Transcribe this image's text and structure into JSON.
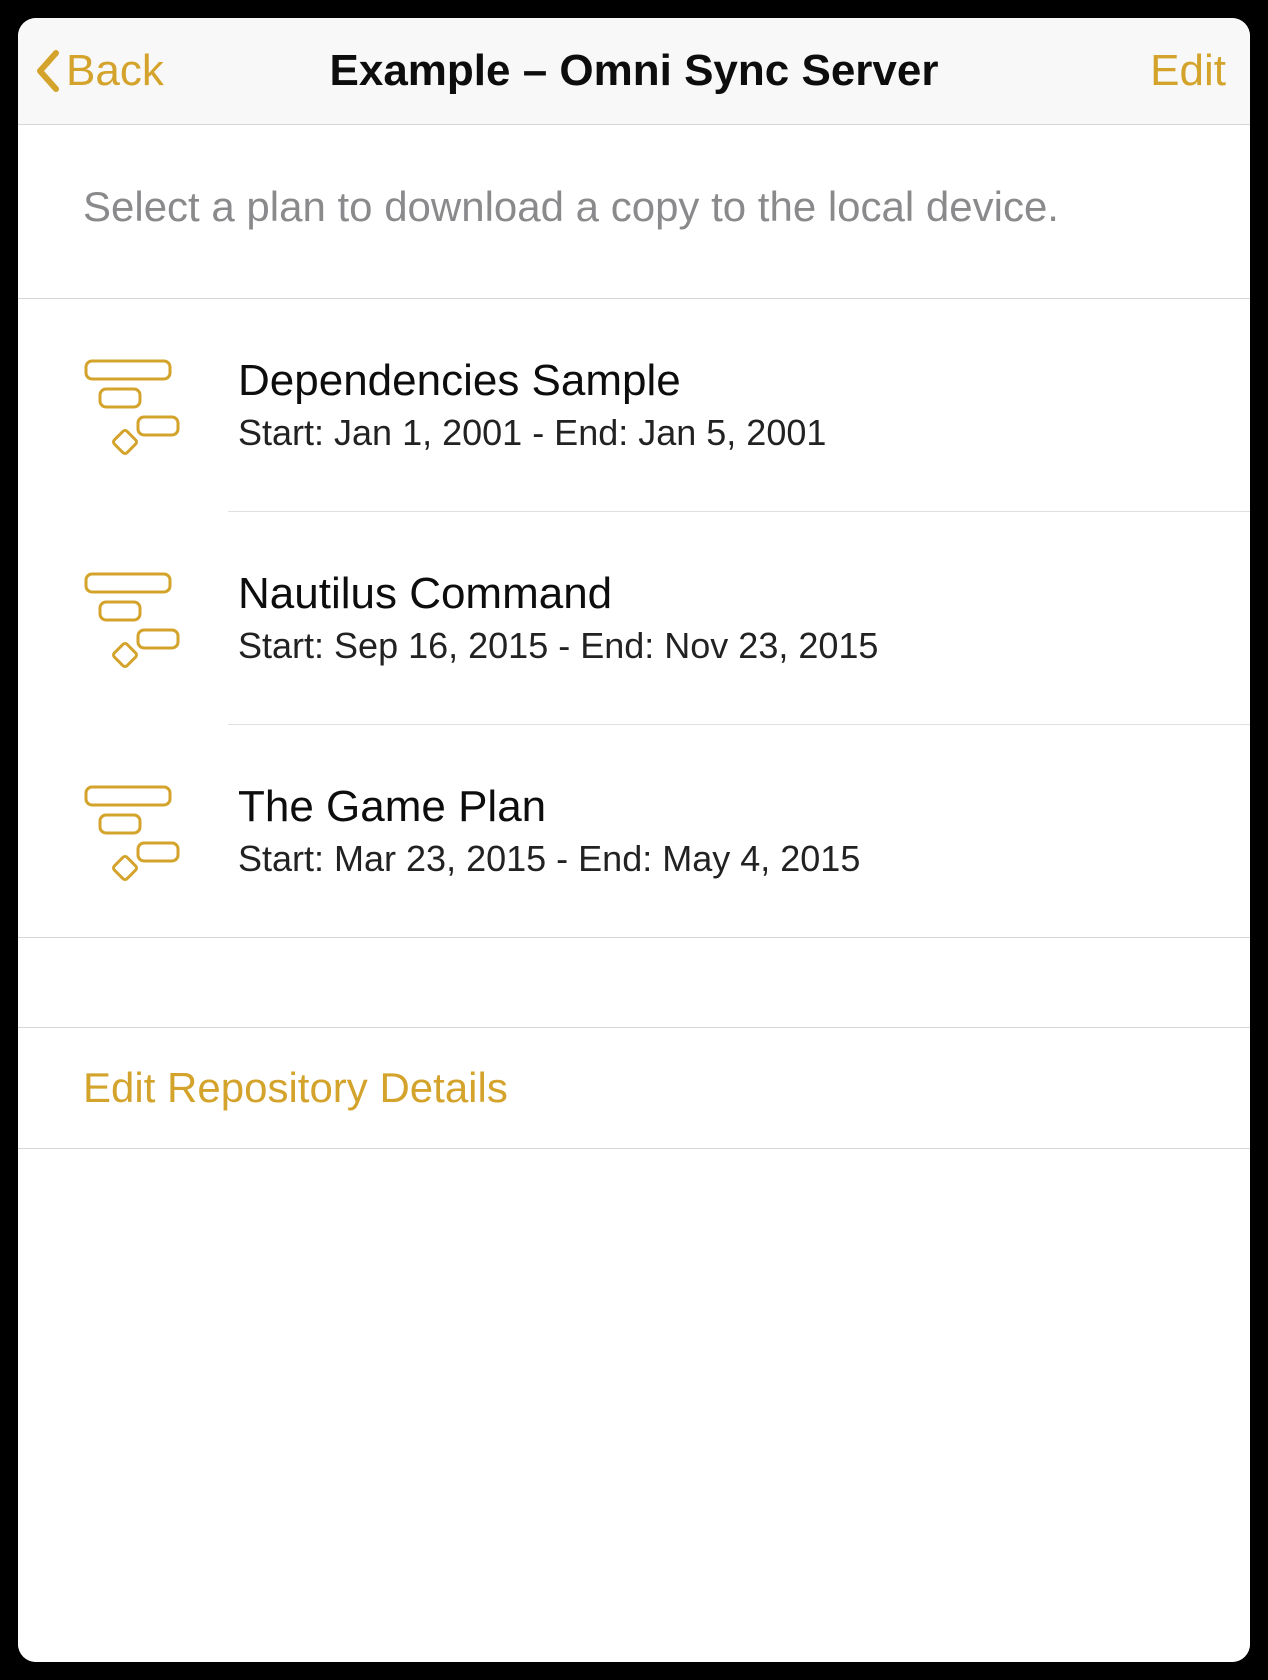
{
  "nav": {
    "back_label": "Back",
    "title": "Example – Omni Sync Server",
    "edit_label": "Edit"
  },
  "instruction": "Select a plan to download a copy to the local device.",
  "plans": [
    {
      "title": "Dependencies Sample",
      "subtitle": "Start: Jan 1, 2001 - End: Jan 5, 2001"
    },
    {
      "title": "Nautilus Command",
      "subtitle": "Start: Sep 16, 2015 - End: Nov 23, 2015"
    },
    {
      "title": "The Game Plan",
      "subtitle": "Start: Mar 23, 2015 - End: May 4, 2015"
    }
  ],
  "footer": {
    "edit_repo_label": "Edit Repository Details"
  },
  "colors": {
    "accent": "#d4a32c"
  }
}
